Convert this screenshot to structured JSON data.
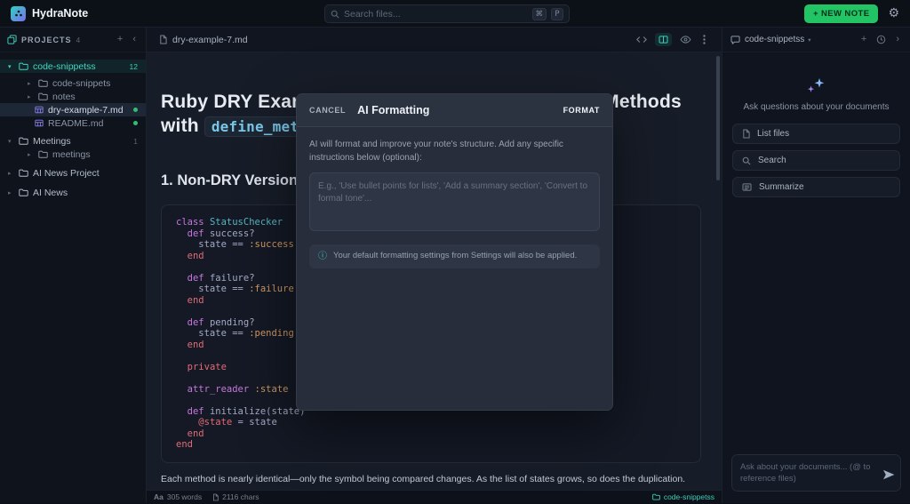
{
  "colors": {
    "accent_teal": "#2dd4bf",
    "new_note_green": "#23c464",
    "file_dot_green": "#2fbf71",
    "inline_code_blue": "#79c7e8"
  },
  "topbar": {
    "app_name": "HydraNote",
    "search_placeholder": "Search files...",
    "shortcut_cmd": "⌘",
    "shortcut_letter": "P",
    "new_note_label": "+ NEW NOTE"
  },
  "projects_panel": {
    "title": "PROJECTS",
    "project_count": "4",
    "tree": [
      {
        "label": "code-snippetss",
        "badge": "12"
      },
      {
        "label": "code-snippets"
      },
      {
        "label": "notes"
      },
      {
        "label": "dry-example-7.md"
      },
      {
        "label": "README.md"
      },
      {
        "label": "Meetings",
        "badge": "1"
      },
      {
        "label": "meetings"
      },
      {
        "label": "AI News Project"
      },
      {
        "label": "AI News"
      }
    ]
  },
  "editor": {
    "tab_title": "dry-example-7.md",
    "title_line1": "Ruby DRY Example: Drying Up Repetitive Status Methods",
    "title_line2_prefix": "with ",
    "title_inline_code": "define_method",
    "section_heading": "1. Non-DRY Version",
    "code_lines": [
      "class StatusChecker",
      "  def success?",
      "    state == :success",
      "  end",
      "",
      "  def failure?",
      "    state == :failure",
      "  end",
      "",
      "  def pending?",
      "    state == :pending",
      "  end",
      "",
      "  private",
      "",
      "  attr_reader :state",
      "",
      "  def initialize(state)",
      "    @state = state",
      "  end",
      "end"
    ],
    "paragraph": "Each method is nearly identical—only the symbol being compared changes. As the list of states grows, so does the duplication.",
    "status_bar": {
      "type_icon": "Aa",
      "word_count": "305 words",
      "char_count": "2116 chars",
      "project_label": "code-snippetss"
    }
  },
  "modal": {
    "cancel_label": "CANCEL",
    "title": "AI Formatting",
    "format_label": "FORMAT",
    "description": "AI will format and improve your note's structure. Add any specific instructions below (optional):",
    "instructions_placeholder": "E.g., 'Use bullet points for lists', 'Add a summary section', 'Convert to formal tone'...",
    "settings_note": "Your default formatting settings from Settings will also be applied."
  },
  "assistant_panel": {
    "project_selector": "code-snippetss",
    "tagline": "Ask questions about your documents",
    "quick_actions": [
      {
        "label": "List files"
      },
      {
        "label": "Search"
      },
      {
        "label": "Summarize"
      }
    ],
    "chat_placeholder": "Ask about your documents... (@ to reference files)"
  }
}
